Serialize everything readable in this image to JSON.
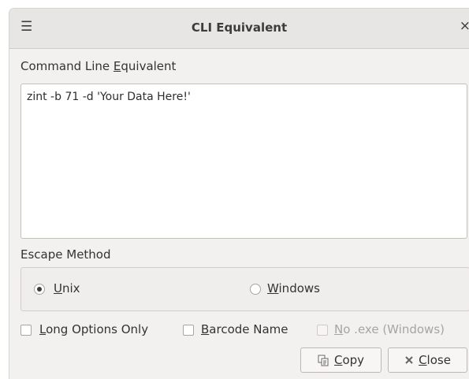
{
  "window": {
    "title": "CLI Equivalent",
    "menu_icon": "☰",
    "close_icon": "×"
  },
  "command_label": {
    "pre": "Command Line ",
    "key": "E",
    "post": "quivalent"
  },
  "command_text": "zint -b 71 -d 'Your Data Here!'",
  "escape_method": {
    "label": "Escape Method",
    "options": [
      {
        "key": "U",
        "rest": "nix",
        "checked": true
      },
      {
        "key": "W",
        "rest": "indows",
        "checked": false
      }
    ]
  },
  "checkboxes": [
    {
      "key": "L",
      "rest": "ong Options Only",
      "checked": false,
      "disabled": false
    },
    {
      "key": "B",
      "rest": "arcode Name",
      "checked": false,
      "disabled": false
    },
    {
      "key": "N",
      "rest": "o .exe (Windows)",
      "checked": false,
      "disabled": true
    }
  ],
  "buttons": {
    "copy": {
      "key": "C",
      "rest": "opy",
      "icon": "copy-icon"
    },
    "close": {
      "key": "C",
      "rest": "lose",
      "icon": "close-icon"
    }
  }
}
